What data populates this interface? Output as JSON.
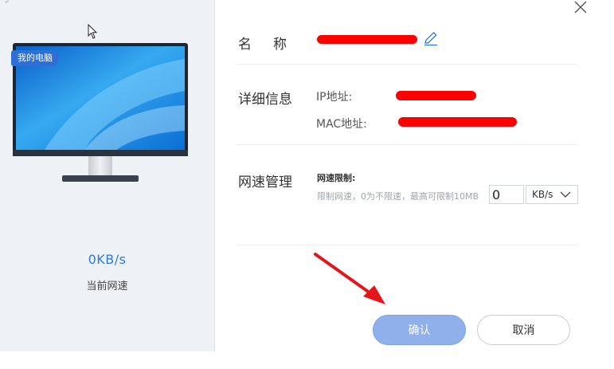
{
  "device": {
    "badge": "我的电脑",
    "speed_value": "0KB/s",
    "speed_label": "当前网速"
  },
  "details": {
    "name_label": "名称",
    "info_label": "详细信息",
    "ip_label": "IP地址:",
    "mac_label": "MAC地址:",
    "speed_section_label": "网速管理",
    "limit_title": "网速限制:",
    "limit_hint": "限制网速，0为不限速，最高可限制10MB",
    "limit_value": "0",
    "unit": "KB/s"
  },
  "buttons": {
    "confirm": "确认",
    "cancel": "取消"
  },
  "colors": {
    "accent": "#2f79d9",
    "redaction": "#ff0000",
    "confirm_bg": "#8fb0ea"
  }
}
